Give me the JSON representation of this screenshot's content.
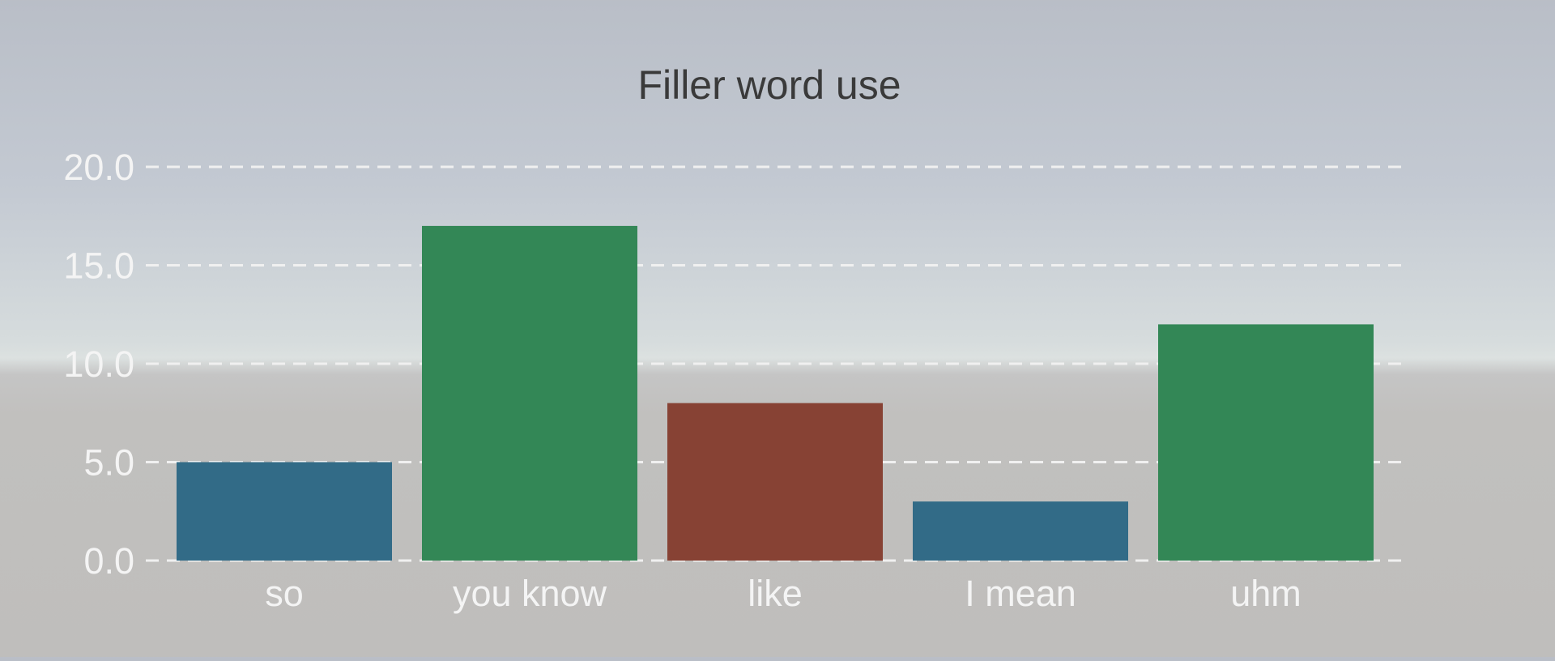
{
  "chart_data": {
    "type": "bar",
    "title": "Filler word use",
    "xlabel": "",
    "ylabel": "",
    "categories": [
      "so",
      "you know",
      "like",
      "I mean",
      "uhm"
    ],
    "values": [
      5,
      17,
      8,
      3,
      12
    ],
    "colors": [
      "#326b87",
      "#338756",
      "#874234",
      "#326b87",
      "#338756"
    ],
    "ylim": [
      0,
      20
    ],
    "yticks": [
      "0.0",
      "5.0",
      "10.0",
      "15.0",
      "20.0"
    ],
    "grid": true,
    "legend": "none"
  }
}
